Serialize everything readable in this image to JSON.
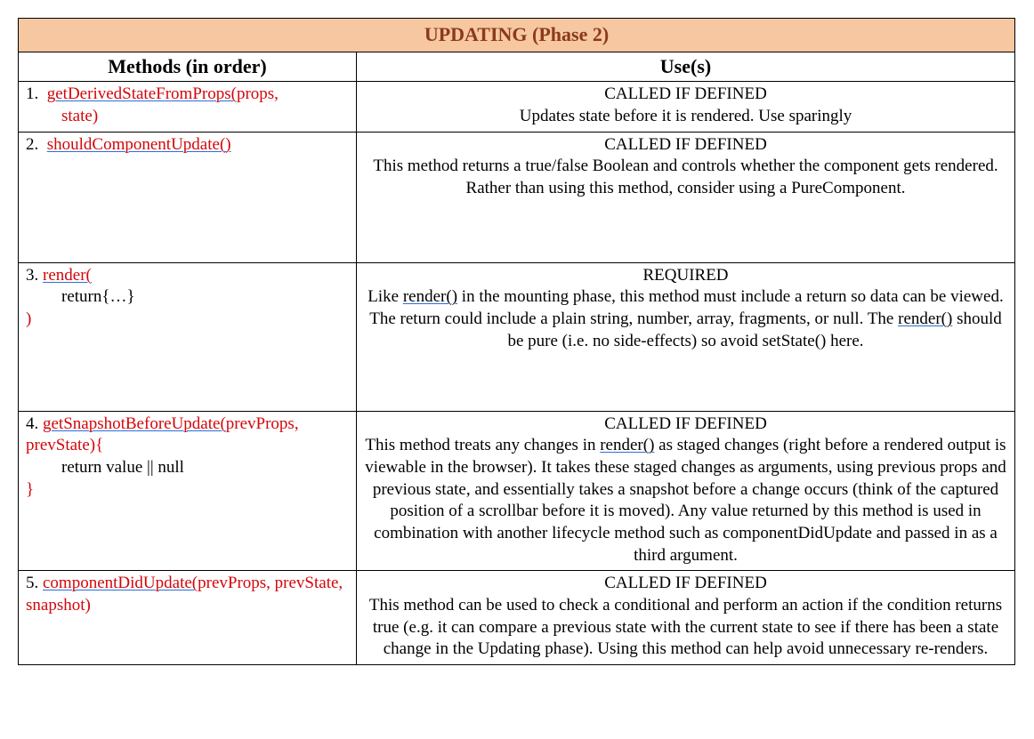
{
  "title": "UPDATING (Phase 2)",
  "headers": {
    "left": "Methods (in order)",
    "right": "Use(s)"
  },
  "rows": [
    {
      "num": "1.",
      "method_link": "getDerivedStateFromProps(",
      "method_tail": "props,",
      "method_line2": "state)",
      "use_head": "CALLED IF DEFINED",
      "use_body": "Updates state before it is rendered. Use sparingly"
    },
    {
      "num": "2.",
      "method_link": "shouldComponentUpdate()",
      "use_head": "CALLED IF DEFINED",
      "use_body": "This method returns a true/false Boolean and controls whether the component gets rendered. Rather than using this method, consider using a PureComponent."
    },
    {
      "num": "3.",
      "method_link": "render(",
      "method_line2": "return{…}",
      "method_line3": ")",
      "use_head": "REQUIRED",
      "use_pre": "Like ",
      "use_u1": "render()",
      "use_mid": " in the mounting phase, this method must include a return so data can be viewed. The return could include a plain string, number, array, fragments, or null. The ",
      "use_u2": "render()",
      "use_post": " should be pure (i.e. no side-effects) so avoid setState() here."
    },
    {
      "num": "4.",
      "method_link": "getSnapshotBeforeUpdate(",
      "method_tail": "prevProps, prevState){",
      "method_line2": "return value || null",
      "method_line3": "}",
      "use_head": "CALLED IF DEFINED",
      "use_pre": "This method treats any changes in ",
      "use_u1": "render()",
      "use_post": " as staged changes (right before a rendered output is viewable in the browser). It takes these staged changes as arguments, using previous props and previous state, and essentially takes a snapshot before a change occurs (think of the captured position of a scrollbar before it is moved). Any value returned by this method is used in combination with another lifecycle method such as componentDidUpdate and passed in as a third argument."
    },
    {
      "num": "5.",
      "method_link": "componentDidUpdate(",
      "method_tail": "prevProps, prevState, snapshot)",
      "use_head": "CALLED IF DEFINED",
      "use_body": "This method can be used to check a conditional and perform an action if the condition returns true (e.g. it can compare a previous state with the current state to see if there has been a state change in the Updating phase). Using this method can help avoid unnecessary re-renders."
    }
  ]
}
